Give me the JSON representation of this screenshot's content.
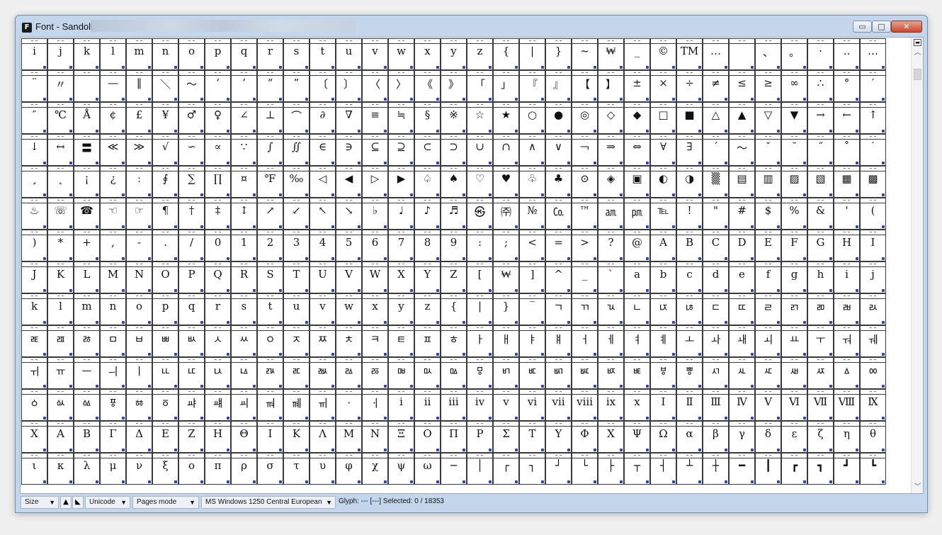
{
  "window": {
    "title": "Font - Sandoll",
    "app_icon_letter": "F",
    "minimize_symbol": "▭",
    "maximize_symbol": "□",
    "close_symbol": "✕"
  },
  "statusbar": {
    "size_label": "Size",
    "encoding_label": "Unicode",
    "mode_label": "Pages mode",
    "codepage_label": "MS Windows 1250 Central European",
    "glyph_info": "Glyph: --- [---]  Selected: 0 / 18353",
    "dropdown_arrow": "▼"
  },
  "glyph_rows": [
    [
      "i",
      "j",
      "k",
      "l",
      "m",
      "n",
      "o",
      "p",
      "q",
      "r",
      "s",
      "t",
      "u",
      "v",
      "w",
      "x",
      "y",
      "z",
      "{",
      "|",
      "}",
      "~",
      "₩",
      "_",
      "©",
      "TM",
      "…",
      "",
      "、",
      "。",
      "·",
      "‥",
      "…"
    ],
    [
      "¨",
      "〃",
      "­",
      "—",
      "‖",
      "＼",
      "～",
      "‘",
      "’",
      "“",
      "”",
      "〔",
      "〕",
      "〈",
      "〉",
      "《",
      "》",
      "「",
      "」",
      "『",
      "』",
      "【",
      "】",
      "±",
      "×",
      "÷",
      "≠",
      "≤",
      "≥",
      "∞",
      "∴",
      "°",
      "′"
    ],
    [
      "″",
      "℃",
      "Å",
      "¢",
      "£",
      "¥",
      "♂",
      "♀",
      "∠",
      "⊥",
      "⌒",
      "∂",
      "∇",
      "≡",
      "≒",
      "§",
      "※",
      "☆",
      "★",
      "○",
      "●",
      "◎",
      "◇",
      "◆",
      "□",
      "■",
      "△",
      "▲",
      "▽",
      "▼",
      "→",
      "←",
      "↑"
    ],
    [
      "↓",
      "↔",
      "〓",
      "≪",
      "≫",
      "√",
      "∽",
      "∝",
      "∵",
      "∫",
      "∬",
      "∈",
      "∋",
      "⊆",
      "⊇",
      "⊂",
      "⊃",
      "∪",
      "∩",
      "∧",
      "∨",
      "￢",
      "⇒",
      "⇔",
      "∀",
      "∃",
      "´",
      "～",
      "ˇ",
      "˘",
      "˝",
      "˚",
      "˙"
    ],
    [
      "¸",
      "˛",
      "¡",
      "¿",
      "ː",
      "∮",
      "∑",
      "∏",
      "¤",
      "℉",
      "‰",
      "◁",
      "◀",
      "▷",
      "▶",
      "♤",
      "♠",
      "♡",
      "♥",
      "♧",
      "♣",
      "⊙",
      "◈",
      "▣",
      "◐",
      "◑",
      "▒",
      "▤",
      "▥",
      "▨",
      "▧",
      "▦",
      "▩"
    ],
    [
      "♨",
      "☏",
      "☎",
      "☜",
      "☞",
      "¶",
      "†",
      "‡",
      "↕",
      "↗",
      "↙",
      "↖",
      "↘",
      "♭",
      "♩",
      "♪",
      "♬",
      "㉿",
      "㈜",
      "№",
      "㏇",
      "™",
      "㏂",
      "㏘",
      "℡",
      "!",
      "\"",
      "#",
      "$",
      "%",
      "&",
      "'",
      "("
    ],
    [
      ")",
      "*",
      "+",
      ",",
      "-",
      ".",
      "/",
      "0",
      "1",
      "2",
      "3",
      "4",
      "5",
      "6",
      "7",
      "8",
      "9",
      ":",
      ";",
      "<",
      "=",
      ">",
      "?",
      "@",
      "A",
      "B",
      "C",
      "D",
      "E",
      "F",
      "G",
      "H",
      "I"
    ],
    [
      "J",
      "K",
      "L",
      "M",
      "N",
      "O",
      "P",
      "Q",
      "R",
      "S",
      "T",
      "U",
      "V",
      "W",
      "X",
      "Y",
      "Z",
      "[",
      "₩",
      "]",
      "^",
      "_",
      "`",
      "a",
      "b",
      "c",
      "d",
      "e",
      "f",
      "g",
      "h",
      "i",
      "j"
    ],
    [
      "k",
      "l",
      "m",
      "n",
      "o",
      "p",
      "q",
      "r",
      "s",
      "t",
      "u",
      "v",
      "w",
      "x",
      "y",
      "z",
      "{",
      "|",
      "}",
      "‾",
      "ㄱ",
      "ㄲ",
      "ㄳ",
      "ㄴ",
      "ㄵ",
      "ㄶ",
      "ㄷ",
      "ㄸ",
      "ㄹ",
      "ㄺ",
      "ㄻ",
      "ㄼ",
      "ㄽ"
    ],
    [
      "ㄾ",
      "ㄿ",
      "ㅀ",
      "ㅁ",
      "ㅂ",
      "ㅃ",
      "ㅄ",
      "ㅅ",
      "ㅆ",
      "ㅇ",
      "ㅈ",
      "ㅉ",
      "ㅊ",
      "ㅋ",
      "ㅌ",
      "ㅍ",
      "ㅎ",
      "ㅏ",
      "ㅐ",
      "ㅑ",
      "ㅒ",
      "ㅓ",
      "ㅔ",
      "ㅕ",
      "ㅖ",
      "ㅗ",
      "ㅘ",
      "ㅙ",
      "ㅚ",
      "ㅛ",
      "ㅜ",
      "ㅝ",
      "ㅞ"
    ],
    [
      "ㅟ",
      "ㅠ",
      "ㅡ",
      "ㅢ",
      "ㅣ",
      "ㅥ",
      "ㅦ",
      "ㅧ",
      "ㅨ",
      "ㅩ",
      "ㅪ",
      "ㅫ",
      "ㅬ",
      "ㅭ",
      "ㅮ",
      "ㅯ",
      "ㅰ",
      "ㅱ",
      "ㅲ",
      "ㅳ",
      "ㅴ",
      "ㅵ",
      "ㅶ",
      "ㅷ",
      "ㅸ",
      "ㅹ",
      "ㅺ",
      "ㅻ",
      "ㅼ",
      "ㅽ",
      "ㅾ",
      "ㅿ",
      "ㆀ"
    ],
    [
      "ㆁ",
      "ㆂ",
      "ㆃ",
      "ㆄ",
      "ㆅ",
      "ㆆ",
      "ㆇ",
      "ㆈ",
      "ㆉ",
      "ㆊ",
      "ㆋ",
      "ㆌ",
      "ㆍ",
      "ㆎ",
      "ⅰ",
      "ⅱ",
      "ⅲ",
      "ⅳ",
      "ⅴ",
      "ⅵ",
      "ⅶ",
      "ⅷ",
      "ⅸ",
      "ⅹ",
      "Ⅰ",
      "Ⅱ",
      "Ⅲ",
      "Ⅳ",
      "Ⅴ",
      "Ⅵ",
      "Ⅶ",
      "Ⅷ",
      "Ⅸ"
    ],
    [
      "Ⅹ",
      "Α",
      "Β",
      "Γ",
      "Δ",
      "Ε",
      "Ζ",
      "Η",
      "Θ",
      "Ι",
      "Κ",
      "Λ",
      "Μ",
      "Ν",
      "Ξ",
      "Ο",
      "Π",
      "Ρ",
      "Σ",
      "Τ",
      "Υ",
      "Φ",
      "Χ",
      "Ψ",
      "Ω",
      "α",
      "β",
      "γ",
      "δ",
      "ε",
      "ζ",
      "η",
      "θ"
    ],
    [
      "ι",
      "κ",
      "λ",
      "μ",
      "ν",
      "ξ",
      "ο",
      "π",
      "ρ",
      "σ",
      "τ",
      "υ",
      "φ",
      "χ",
      "ψ",
      "ω",
      "─",
      "│",
      "┌",
      "┐",
      "┘",
      "└",
      "├",
      "┬",
      "┤",
      "┴",
      "┼",
      "━",
      "┃",
      "┏",
      "┓",
      "┛",
      "┗"
    ]
  ]
}
